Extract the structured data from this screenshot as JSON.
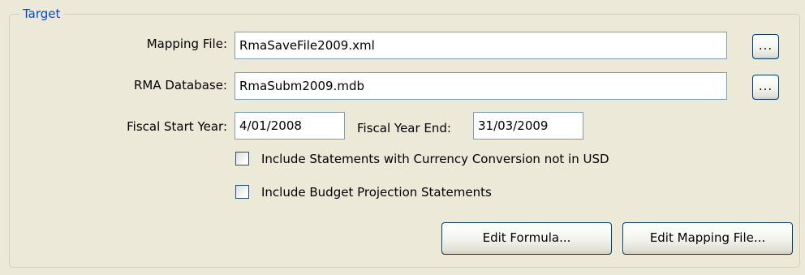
{
  "group": {
    "title": "Target"
  },
  "mapping_file": {
    "label": "Mapping File:",
    "value": "RmaSaveFile2009.xml",
    "browse_label": "..."
  },
  "rma_database": {
    "label": "RMA Database:",
    "value": "RmaSubm2009.mdb",
    "browse_label": "..."
  },
  "fiscal": {
    "start_label": "Fiscal Start Year:",
    "start_value": "4/01/2008",
    "end_label": "Fiscal Year End:",
    "end_value": "31/03/2009"
  },
  "options": [
    {
      "label": "Include Statements with Currency Conversion not in USD",
      "checked": false
    },
    {
      "label": "Include Budget Projection Statements",
      "checked": false
    }
  ],
  "buttons": {
    "edit_formula": "Edit Formula...",
    "edit_mapping_file": "Edit Mapping File..."
  }
}
